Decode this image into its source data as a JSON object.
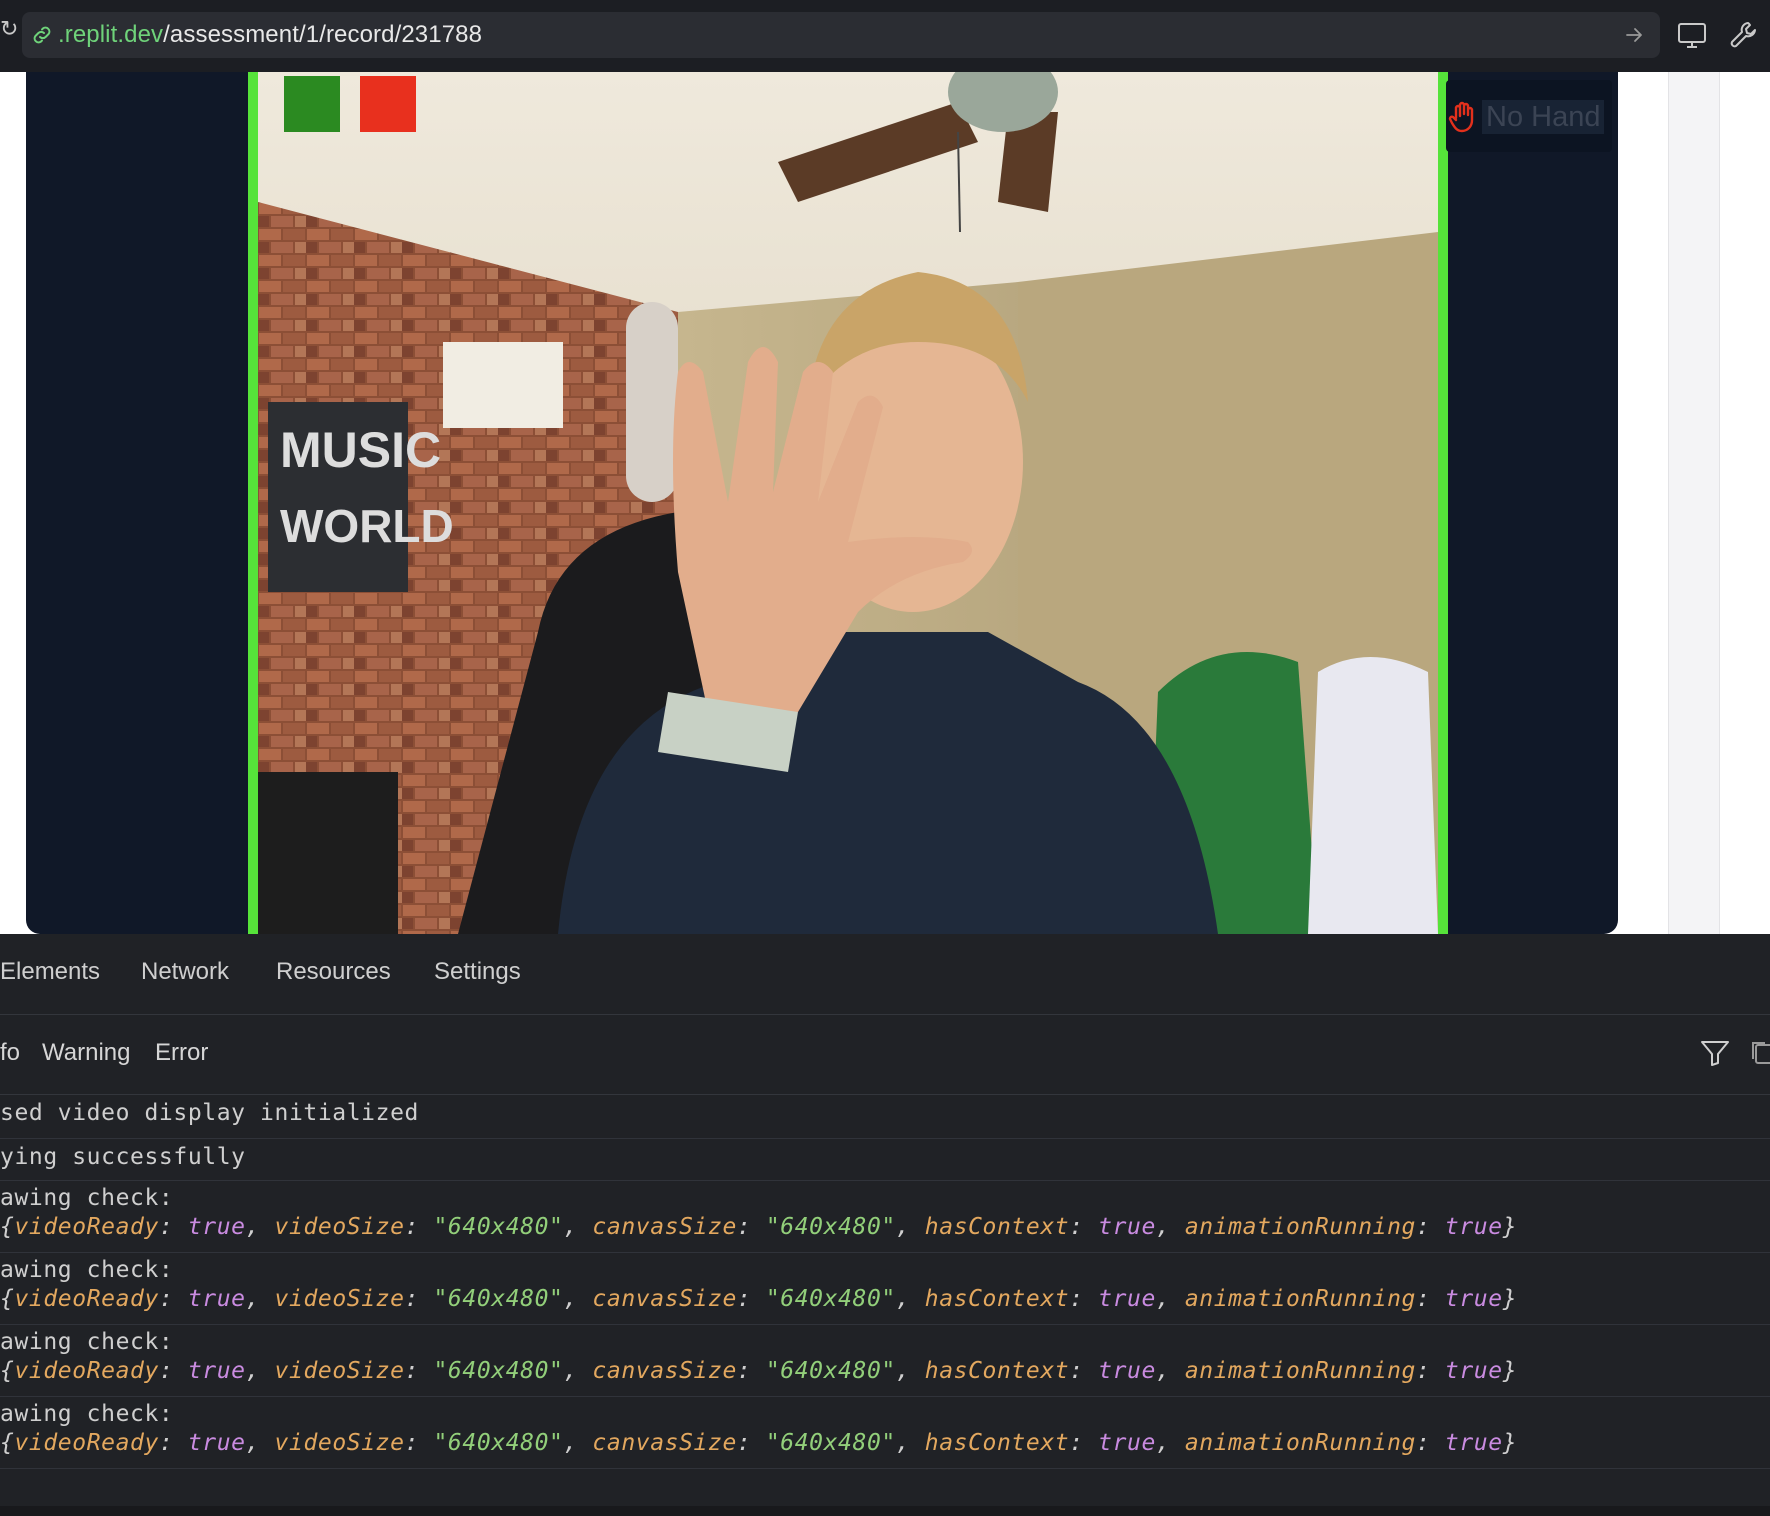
{
  "urlbar": {
    "domain": ".replit.dev",
    "path": "/assessment/1/record/231788"
  },
  "video": {
    "hand_status": "No Hand",
    "indicators": [
      {
        "name": "green",
        "color": "#2b8a21"
      },
      {
        "name": "red",
        "color": "#e8301e"
      }
    ],
    "border_color": "#56e33a"
  },
  "devtools": {
    "tabs": [
      "Elements",
      "Network",
      "Resources",
      "Settings"
    ],
    "levels": [
      "fo",
      "Warning",
      "Error"
    ],
    "logs": [
      {
        "text": "sed video display initialized"
      },
      {
        "text": "ying successfully"
      },
      {
        "label": "awing check:",
        "object": {
          "videoReady": "true",
          "videoSize": "\"640x480\"",
          "canvasSize": "\"640x480\"",
          "hasContext": "true",
          "animationRunning": "true"
        }
      },
      {
        "label": "awing check:",
        "object": {
          "videoReady": "true",
          "videoSize": "\"640x480\"",
          "canvasSize": "\"640x480\"",
          "hasContext": "true",
          "animationRunning": "true"
        }
      },
      {
        "label": "awing check:",
        "object": {
          "videoReady": "true",
          "videoSize": "\"640x480\"",
          "canvasSize": "\"640x480\"",
          "hasContext": "true",
          "animationRunning": "true"
        }
      },
      {
        "label": "awing check:",
        "object": {
          "videoReady": "true",
          "videoSize": "\"640x480\"",
          "canvasSize": "\"640x480\"",
          "hasContext": "true",
          "animationRunning": "true"
        }
      }
    ]
  }
}
